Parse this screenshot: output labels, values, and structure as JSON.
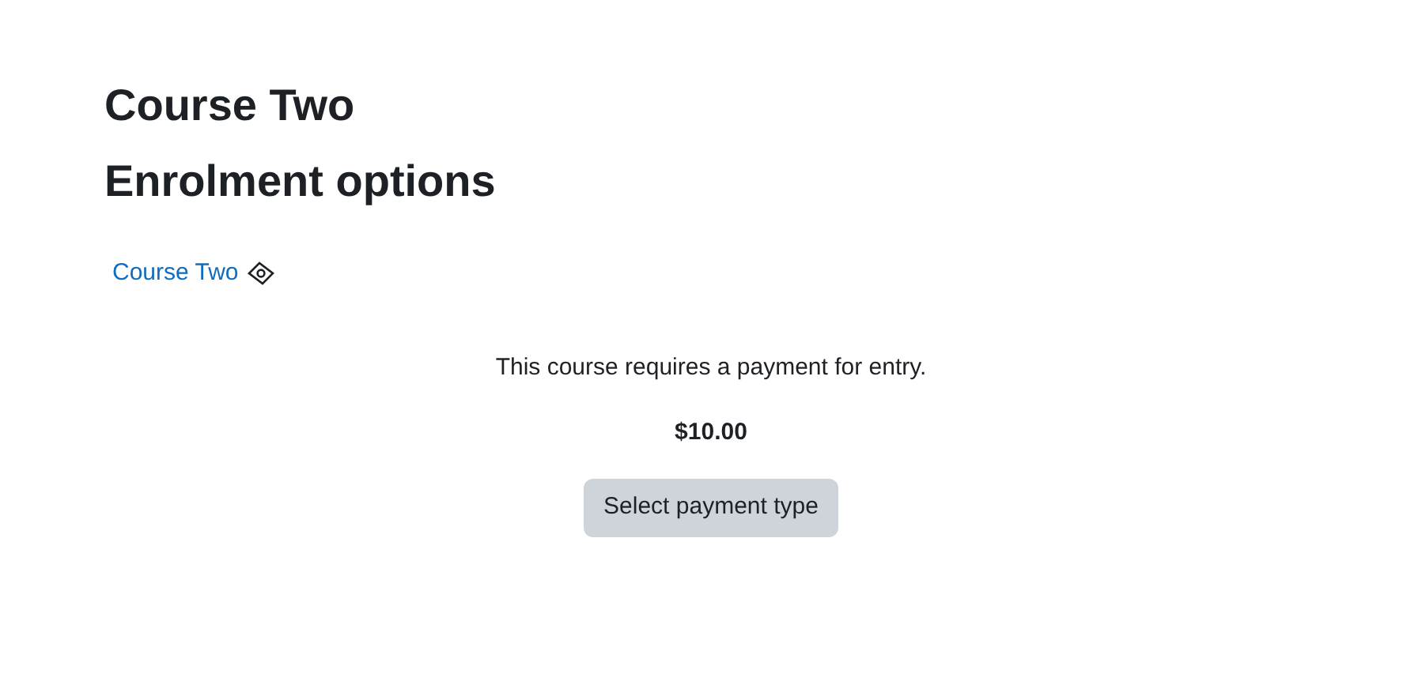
{
  "page_title": "Course Two",
  "section_title": "Enrolment options",
  "course_link": "Course Two",
  "message": "This course requires a payment for entry.",
  "price": "$10.00",
  "button": "Select payment type"
}
